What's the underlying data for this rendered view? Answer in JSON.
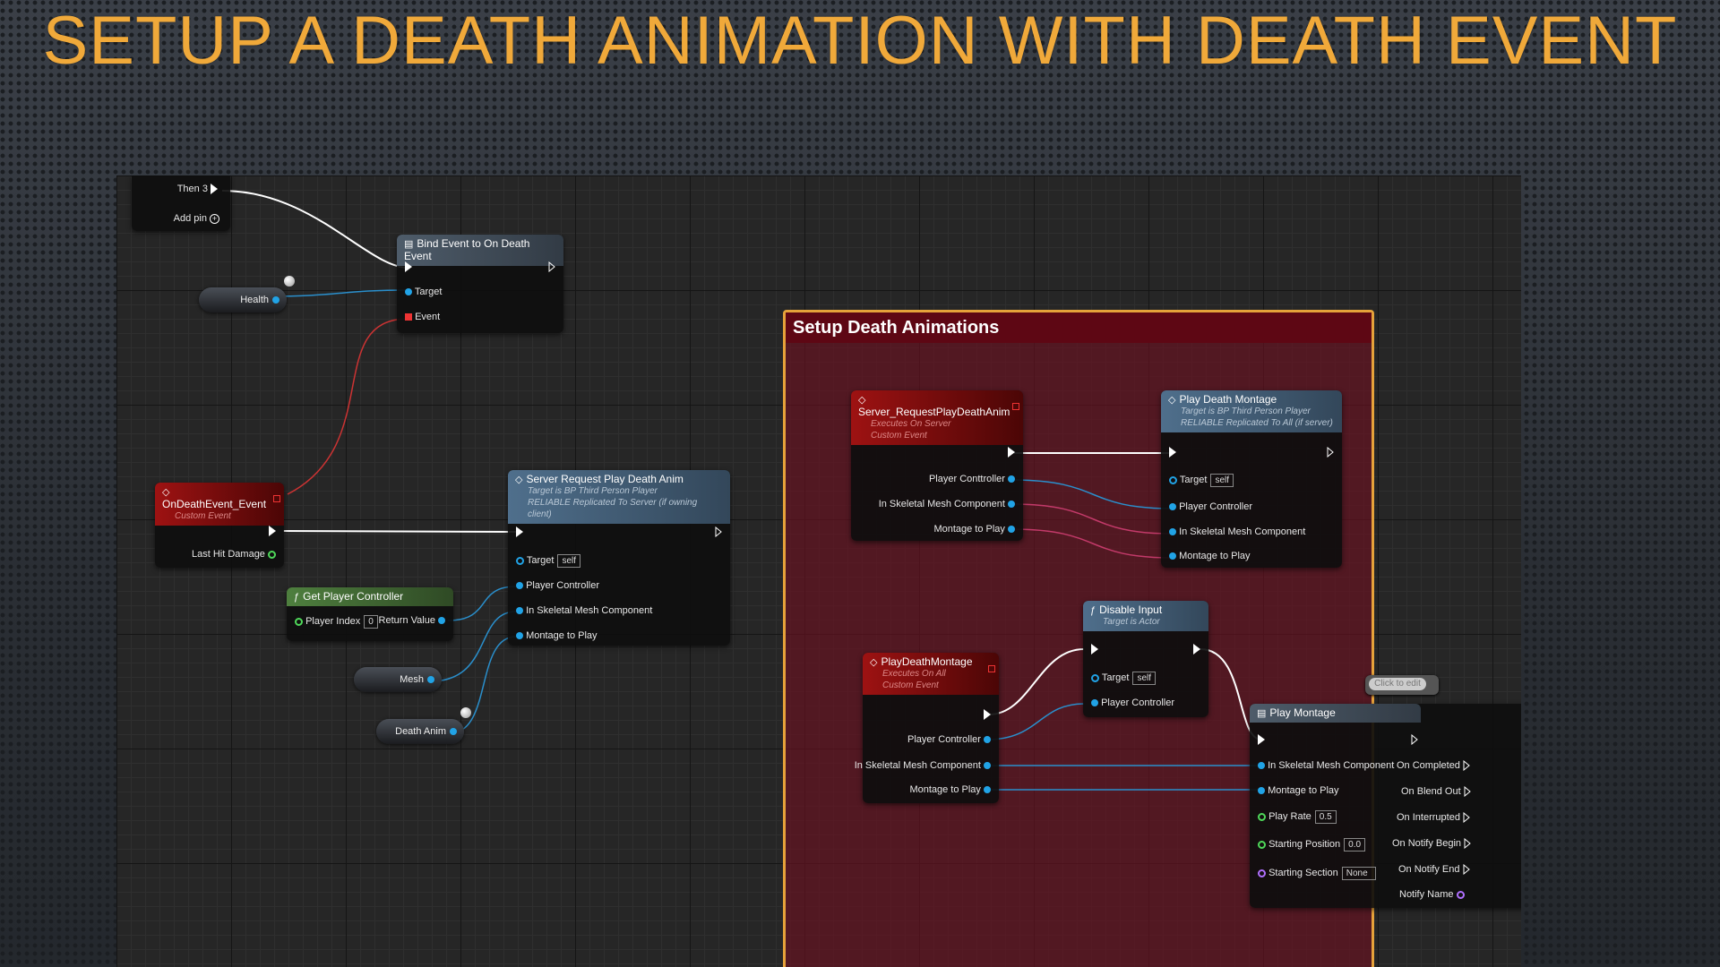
{
  "slide": {
    "title": "SETUP A DEATH ANIMATION WITH DEATH EVENT"
  },
  "colors": {
    "title": "#f0a93a",
    "comment_border": "#e6a23a",
    "comment_header": "#5e0714",
    "data_pin": "#21a3e6",
    "event_pin": "#ee3333",
    "exec_wire": "#ffffff"
  },
  "sequence": {
    "then_label": "Then 3",
    "add_pin_label": "Add pin"
  },
  "bind_event": {
    "title": "Bind Event to On Death Event",
    "target": "Target",
    "event": "Event"
  },
  "variables": {
    "health": "Health",
    "mesh": "Mesh",
    "death_anim": "Death Anim"
  },
  "on_death_event": {
    "title": "OnDeathEvent_Event",
    "subtitle": "Custom Event",
    "last_hit": "Last Hit Damage"
  },
  "get_player_controller": {
    "title": "Get Player Controller",
    "player_index": "Player Index",
    "player_index_value": "0",
    "return_value": "Return Value"
  },
  "server_request_node": {
    "title": "Server Request Play Death Anim",
    "sub1": "Target is BP Third Person Player",
    "sub2": "RELIABLE Replicated To Server (if owning client)",
    "target": "Target",
    "target_value": "self",
    "player_controller": "Player Controller",
    "mesh_component": "In Skeletal Mesh Component",
    "montage": "Montage to Play"
  },
  "comment": {
    "title": "Setup Death Animations"
  },
  "server_event": {
    "title": "Server_RequestPlayDeathAnim",
    "sub1": "Executes On Server",
    "sub2": "Custom Event",
    "player_controller": "Player Conttroller",
    "mesh_component": "In Skeletal Mesh Component",
    "montage": "Montage to Play"
  },
  "play_death_montage_call": {
    "title": "Play Death Montage",
    "sub1": "Target is BP Third Person Player",
    "sub2": "RELIABLE Replicated To All (if server)",
    "target": "Target",
    "target_value": "self",
    "player_controller": "Player Controller",
    "mesh_component": "In Skeletal Mesh Component",
    "montage": "Montage to Play"
  },
  "multicast_event": {
    "title": "PlayDeathMontage",
    "sub1": "Executes On All",
    "sub2": "Custom Event",
    "player_controller": "Player Controller",
    "mesh_component": "In Skeletal Mesh Component",
    "montage": "Montage to Play"
  },
  "disable_input": {
    "title": "Disable Input",
    "sub1": "Target is Actor",
    "target": "Target",
    "target_value": "self",
    "player_controller": "Player Controller"
  },
  "click_to_edit": "Click to edit",
  "play_montage": {
    "title": "Play Montage",
    "mesh_component": "In Skeletal Mesh Component",
    "montage": "Montage to Play",
    "play_rate": "Play Rate",
    "play_rate_value": "0.5",
    "start_pos": "Starting Position",
    "start_pos_value": "0.0",
    "start_section": "Starting Section",
    "start_section_value": "None",
    "on_completed": "On Completed",
    "on_blend_out": "On Blend Out",
    "on_interrupted": "On Interrupted",
    "on_notify_begin": "On Notify Begin",
    "on_notify_end": "On Notify End",
    "notify_name": "Notify Name"
  }
}
